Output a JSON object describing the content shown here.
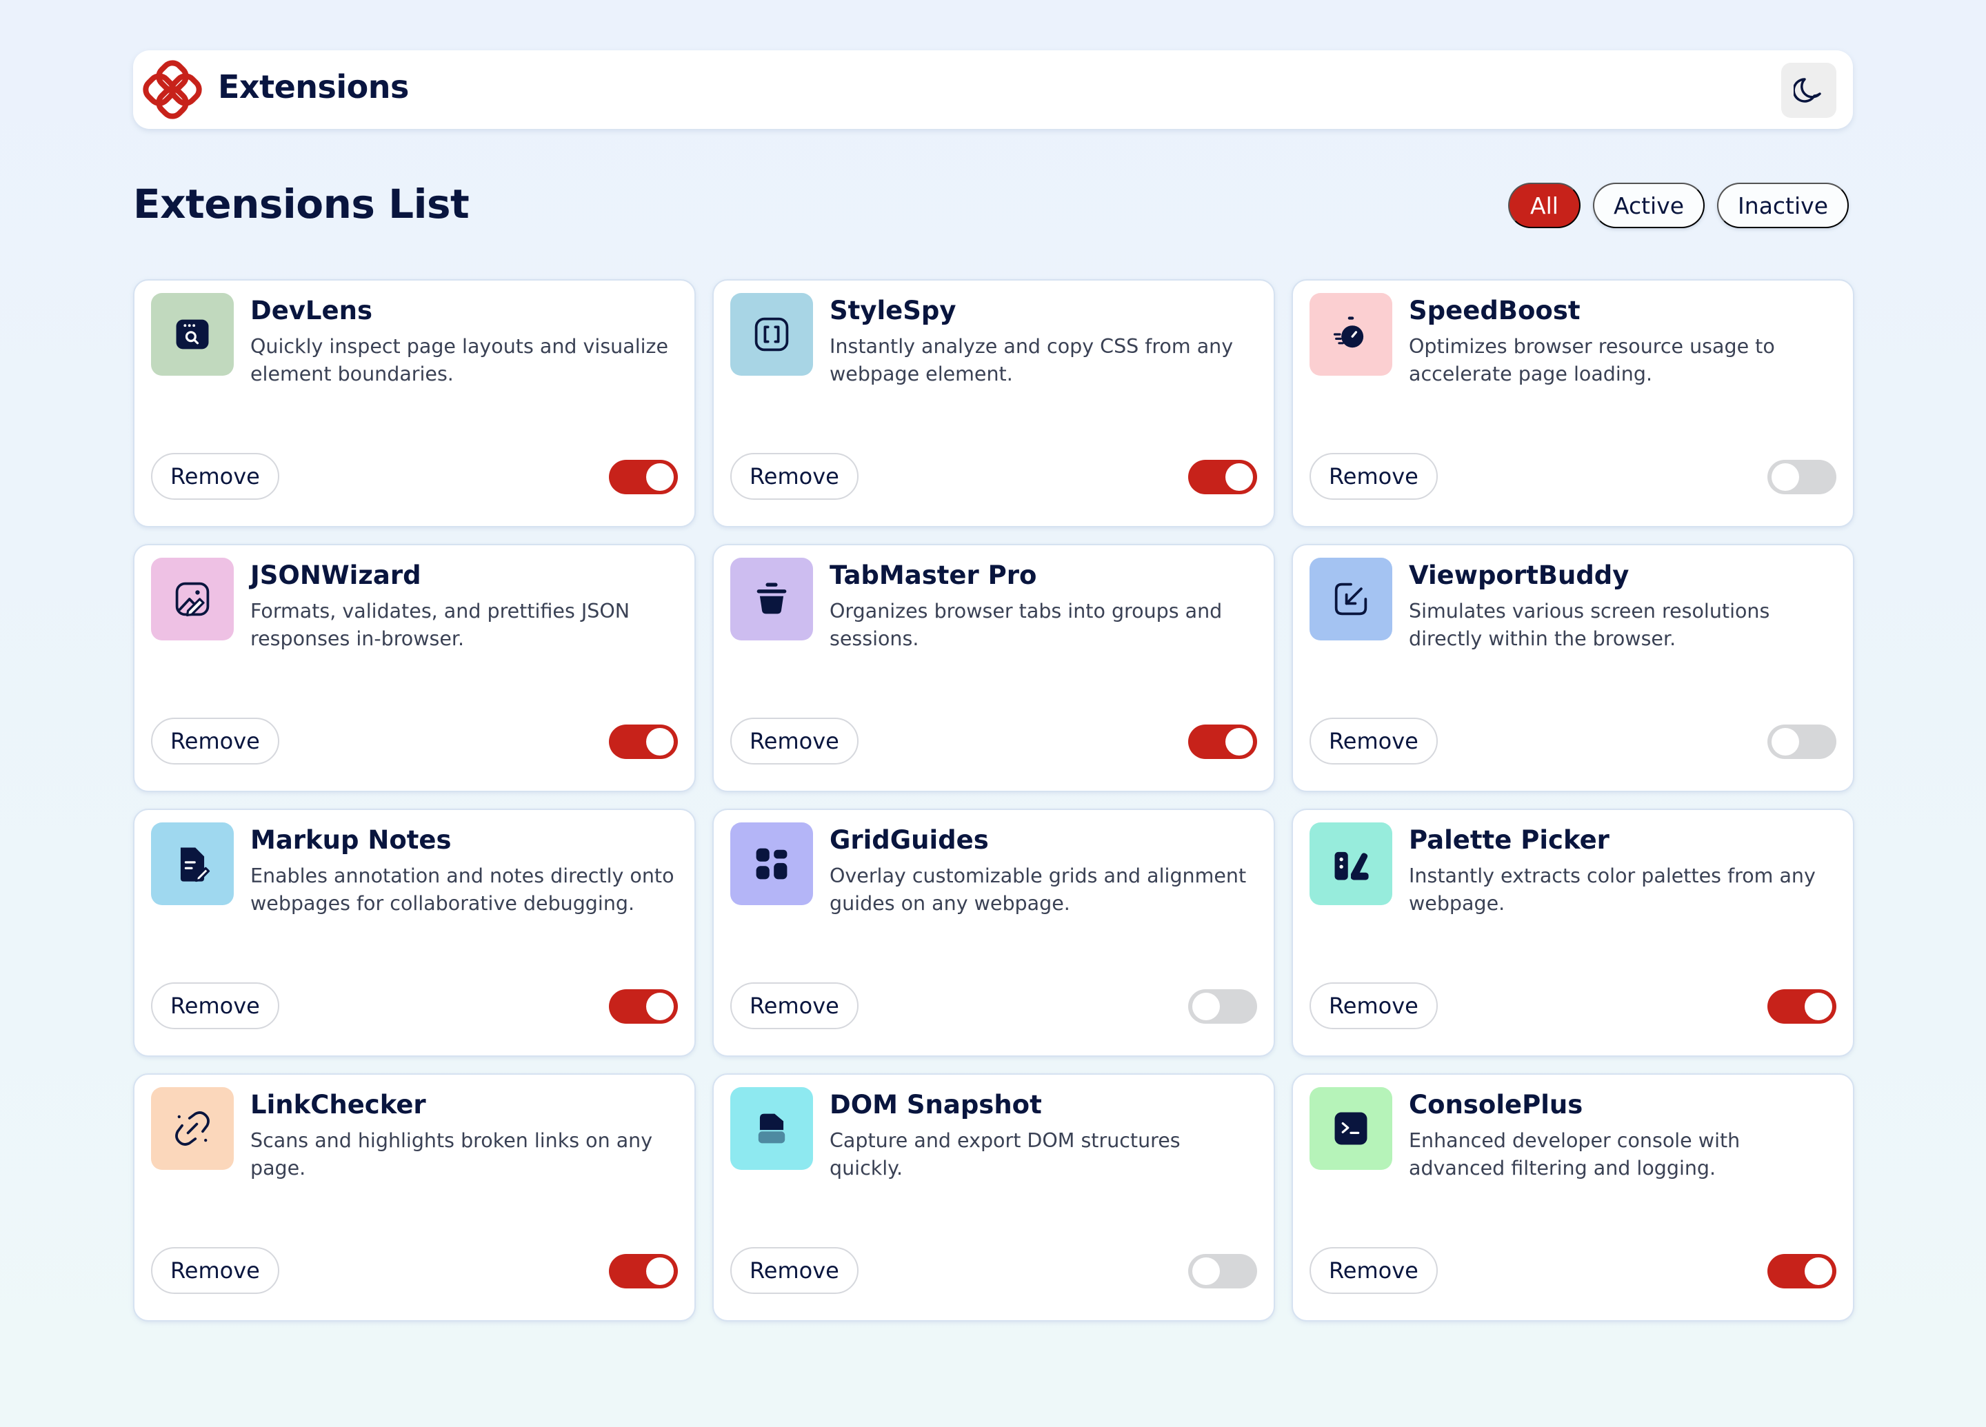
{
  "header": {
    "brand": "Extensions",
    "logo_icon": "logo-icon",
    "theme_icon": "moon-icon"
  },
  "main": {
    "title": "Extensions List",
    "filters": [
      {
        "label": "All",
        "selected": true
      },
      {
        "label": "Active",
        "selected": false
      },
      {
        "label": "Inactive",
        "selected": false
      }
    ]
  },
  "colors": {
    "accent": "#c7221a",
    "text": "#09153e",
    "toggle_off": "#d6d7d9"
  },
  "remove_label": "Remove",
  "extensions": [
    {
      "name": "DevLens",
      "description": "Quickly inspect page layouts and visualize element boundaries.",
      "active": true,
      "icon": "browser-search-icon",
      "icon_bg": "#c1d9be"
    },
    {
      "name": "StyleSpy",
      "description": "Instantly analyze and copy CSS from any webpage element.",
      "active": true,
      "icon": "brackets-icon",
      "icon_bg": "#a8d5e5"
    },
    {
      "name": "SpeedBoost",
      "description": "Optimizes browser resource usage to accelerate page loading.",
      "active": false,
      "icon": "stopwatch-icon",
      "icon_bg": "#fbcfd1"
    },
    {
      "name": "JSONWizard",
      "description": "Formats, validates, and prettifies JSON responses in-browser.",
      "active": true,
      "icon": "image-edit-icon",
      "icon_bg": "#eec1e4"
    },
    {
      "name": "TabMaster Pro",
      "description": "Organizes browser tabs into groups and sessions.",
      "active": true,
      "icon": "pot-icon",
      "icon_bg": "#cdbdf0"
    },
    {
      "name": "ViewportBuddy",
      "description": "Simulates various screen resolutions directly within the browser.",
      "active": false,
      "icon": "resize-arrow-icon",
      "icon_bg": "#a4c3f2"
    },
    {
      "name": "Markup Notes",
      "description": "Enables annotation and notes directly onto webpages for collaborative debugging.",
      "active": true,
      "icon": "document-edit-icon",
      "icon_bg": "#9fd8ef"
    },
    {
      "name": "GridGuides",
      "description": "Overlay customizable grids and alignment guides on any webpage.",
      "active": false,
      "icon": "grid-blocks-icon",
      "icon_bg": "#b4b5f7"
    },
    {
      "name": "Palette Picker",
      "description": "Instantly extracts color palettes from any webpage.",
      "active": true,
      "icon": "swatches-icon",
      "icon_bg": "#97ecdc"
    },
    {
      "name": "LinkChecker",
      "description": "Scans and highlights broken links on any page.",
      "active": true,
      "icon": "broken-link-icon",
      "icon_bg": "#fbd7bb"
    },
    {
      "name": "DOM Snapshot",
      "description": "Capture and export DOM structures quickly.",
      "active": false,
      "icon": "snapshot-icon",
      "icon_bg": "#8ee9f0"
    },
    {
      "name": "ConsolePlus",
      "description": "Enhanced developer console with advanced filtering and logging.",
      "active": true,
      "icon": "terminal-icon",
      "icon_bg": "#b6f3b9"
    }
  ]
}
